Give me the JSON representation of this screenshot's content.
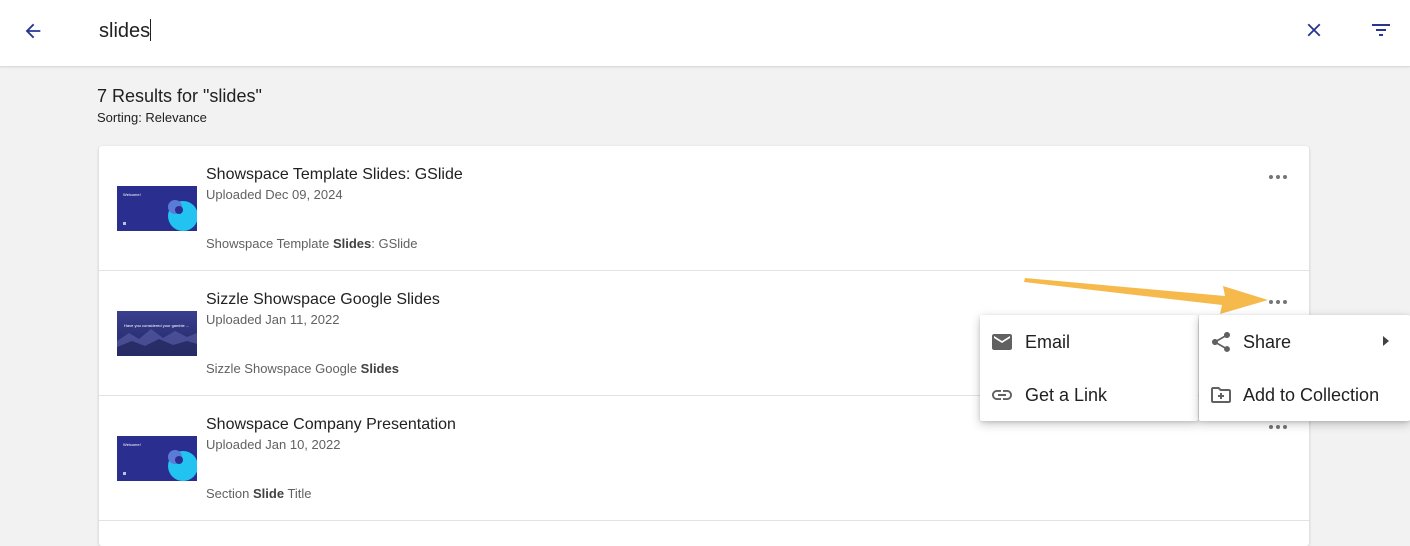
{
  "search": {
    "query": "slides",
    "placeholder": ""
  },
  "results": {
    "title": "7 Results for \"slides\"",
    "sorting": "Sorting: Relevance",
    "items": [
      {
        "title": "Showspace Template Slides: GSlide",
        "uploaded": "Uploaded Dec 09, 2024",
        "snippet_pre": "Showspace Template ",
        "snippet_bold": "Slides",
        "snippet_post": ": GSlide",
        "thumb_text": "Welcome!"
      },
      {
        "title": "Sizzle Showspace Google Slides",
        "uploaded": "Uploaded Jan 11, 2022",
        "snippet_pre": "Sizzle Showspace Google ",
        "snippet_bold": "Slides",
        "snippet_post": "",
        "thumb_text": "Have you considered your gamble ..."
      },
      {
        "title": "Showspace Company Presentation",
        "uploaded": "Uploaded Jan 10, 2022",
        "snippet_pre": "Section ",
        "snippet_bold": "Slide",
        "snippet_post": " Title",
        "thumb_text": "Welcome!"
      }
    ]
  },
  "context_menu": {
    "left": [
      {
        "label": "Email",
        "icon": "email-icon"
      },
      {
        "label": "Get a Link",
        "icon": "link-icon"
      }
    ],
    "right": [
      {
        "label": "Share",
        "icon": "share-icon",
        "has_submenu": true
      },
      {
        "label": "Add to Collection",
        "icon": "add-to-collection-icon"
      }
    ]
  },
  "colors": {
    "accent": "#283593",
    "annotation_arrow": "#f5b642",
    "background": "#f2f2f2"
  }
}
